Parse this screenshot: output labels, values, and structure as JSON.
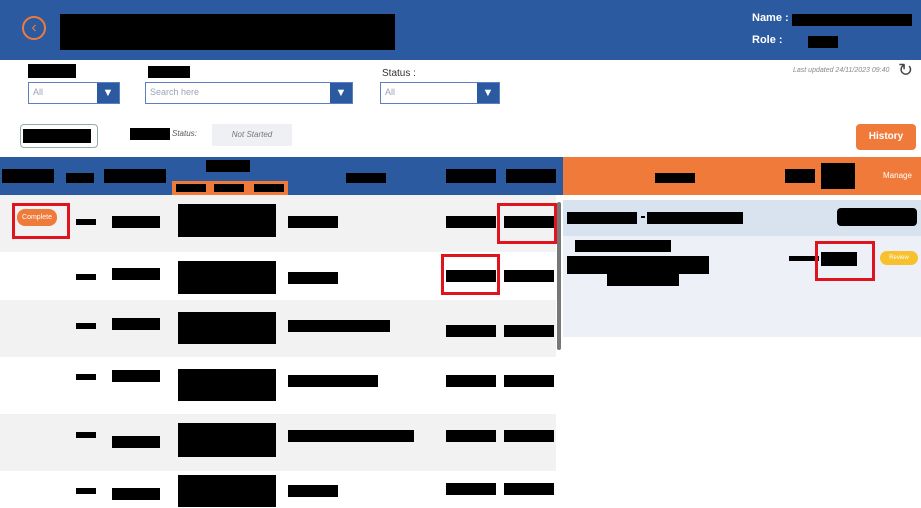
{
  "header": {
    "name_label": "Name :",
    "role_label": "Role :",
    "back_icon": "chevron-left-icon"
  },
  "filters": {
    "filter1_value": "All",
    "search_placeholder": "Search here",
    "status_label": "Status :",
    "status_value": "All",
    "last_updated": "Last updated 24/11/2023 09:40",
    "refresh_icon": "refresh-icon"
  },
  "toolbar": {
    "status_label": "Status:",
    "status_value": "Not Started",
    "history_label": "History"
  },
  "right_table": {
    "manage_label": "Manage"
  },
  "rows": {
    "complete_label": "Complete",
    "review_label": "Review"
  },
  "colors": {
    "header_blue": "#2c5aa0",
    "accent_orange": "#f07a3a",
    "review_yellow": "#f6c12c",
    "highlight_red": "#e0141e"
  }
}
